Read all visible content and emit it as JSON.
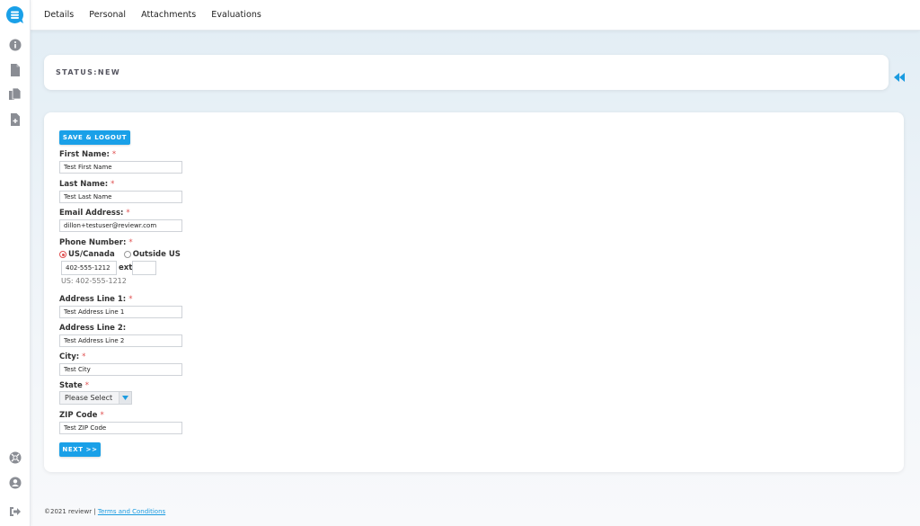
{
  "sidebar": {
    "logo": "reviewr-logo",
    "top_icons": [
      {
        "name": "info-icon",
        "label": "Details"
      },
      {
        "name": "document-icon",
        "label": "Personal"
      },
      {
        "name": "documents-icon",
        "label": "Attachments"
      },
      {
        "name": "add-document-icon",
        "label": "Evaluations"
      }
    ],
    "bottom_icons": [
      {
        "name": "help-icon"
      },
      {
        "name": "user-icon"
      },
      {
        "name": "logout-icon"
      }
    ]
  },
  "topbar": {
    "tabs": [
      {
        "label": "Details"
      },
      {
        "label": "Personal"
      },
      {
        "label": "Attachments"
      },
      {
        "label": "Evaluations"
      }
    ]
  },
  "status": {
    "text": "STATUS:NEW"
  },
  "form": {
    "save_logout_label": "SAVE & LOGOUT",
    "next_label": "NEXT >>",
    "required_mark": "*",
    "first_name": {
      "label": "First Name:",
      "value": "Test First Name"
    },
    "last_name": {
      "label": "Last Name:",
      "value": "Test Last Name"
    },
    "email": {
      "label": "Email Address:",
      "value": "dillon+testuser@reviewr.com"
    },
    "phone": {
      "label": "Phone Number:",
      "options": [
        {
          "label": "US/Canada",
          "checked": true
        },
        {
          "label": "Outside US",
          "checked": false
        }
      ],
      "value": "402-555-1212",
      "ext_label": "ext",
      "ext_value": "",
      "formatted": "US: 402-555-1212"
    },
    "address1": {
      "label": "Address Line 1:",
      "value": "Test Address Line 1"
    },
    "address2": {
      "label": "Address Line 2:",
      "value": "Test Address Line 2"
    },
    "city": {
      "label": "City:",
      "value": "Test City"
    },
    "state": {
      "label": "State",
      "value": "Please Select"
    },
    "zip": {
      "label": "ZIP Code",
      "value": "Test ZIP Code"
    }
  },
  "footer": {
    "copyright": "©2021 reviewr | ",
    "terms_link": "Terms and Conditions"
  },
  "colors": {
    "accent": "#1aa0e8",
    "required": "#e05050",
    "icon_gray": "#8a8d94"
  }
}
